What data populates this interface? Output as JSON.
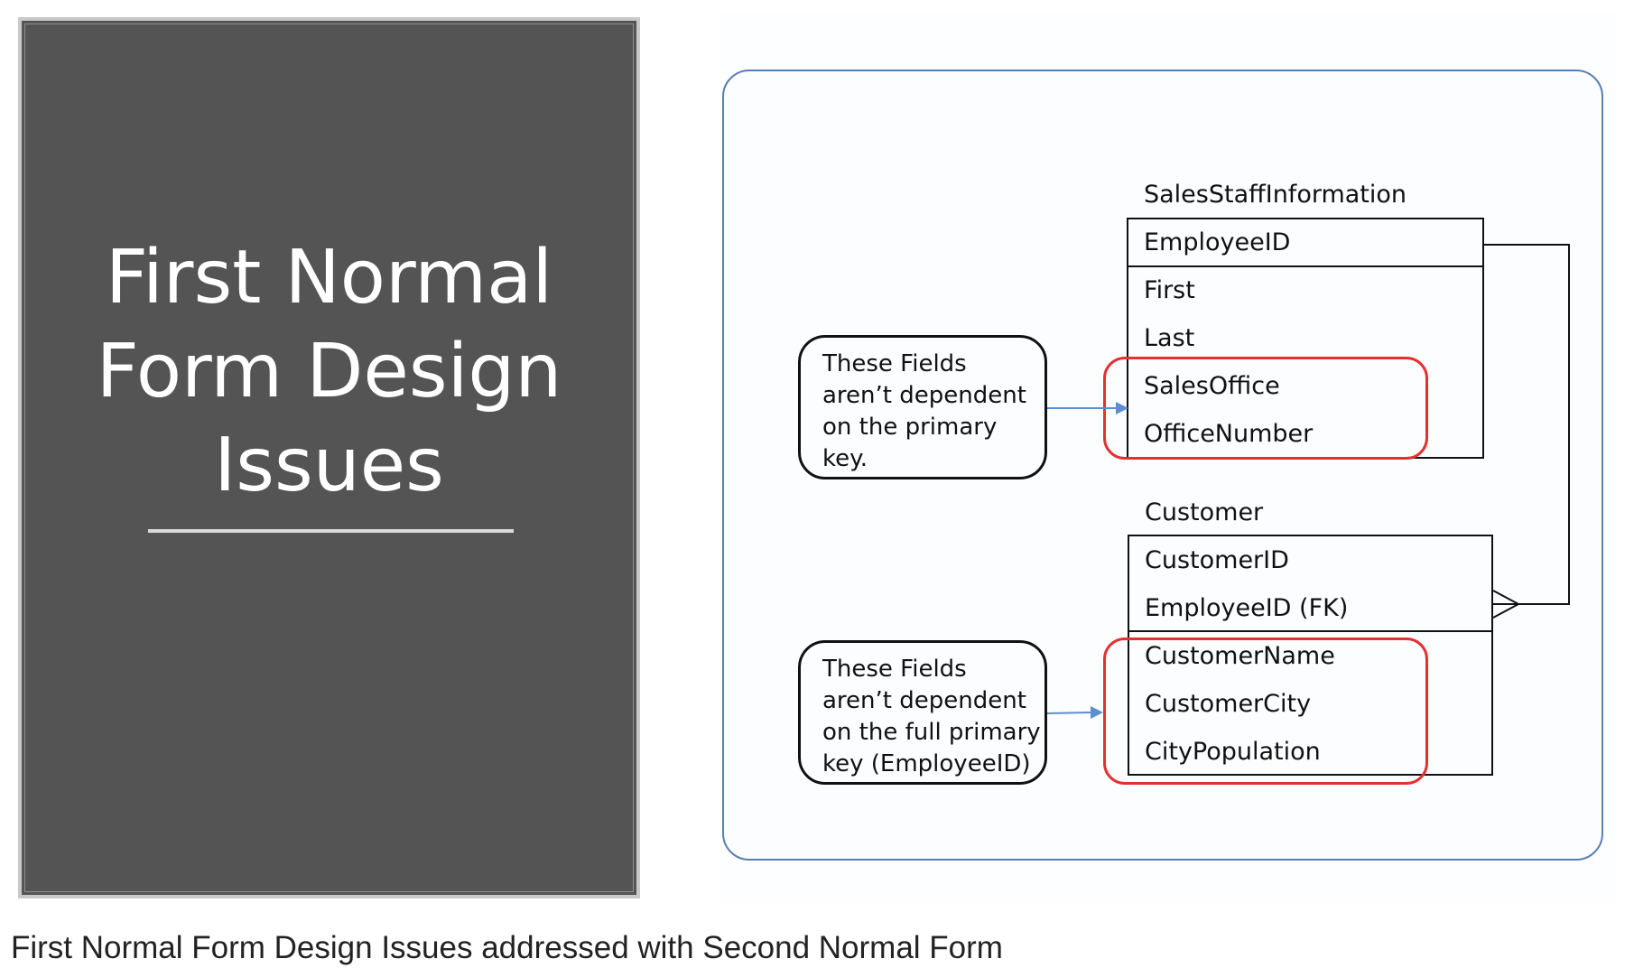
{
  "slide": {
    "title_lines": [
      "First Normal",
      "Form Design",
      "Issues"
    ]
  },
  "diagram": {
    "sales_table": {
      "name": "SalesStaffInformation",
      "key_fields": [
        "EmployeeID"
      ],
      "fields": [
        "First",
        "Last",
        "SalesOffice",
        "OfficeNumber"
      ]
    },
    "customer_table": {
      "name": "Customer",
      "key_fields": [
        "CustomerID",
        "EmployeeID (FK)"
      ],
      "fields": [
        "CustomerName",
        "CustomerCity",
        "CityPopulation"
      ]
    },
    "note_top": "These Fields\naren’t dependent\non the primary\nkey.",
    "note_bottom": "These Fields\naren’t dependent\non the full primary\nkey (EmployeeID)",
    "colors": {
      "highlight": "#e53030",
      "arrow": "#5b8fd0",
      "frame": "#5a7fb0",
      "slide_bg": "#545454"
    }
  },
  "caption": "First Normal Form Design Issues addressed with Second Normal Form"
}
